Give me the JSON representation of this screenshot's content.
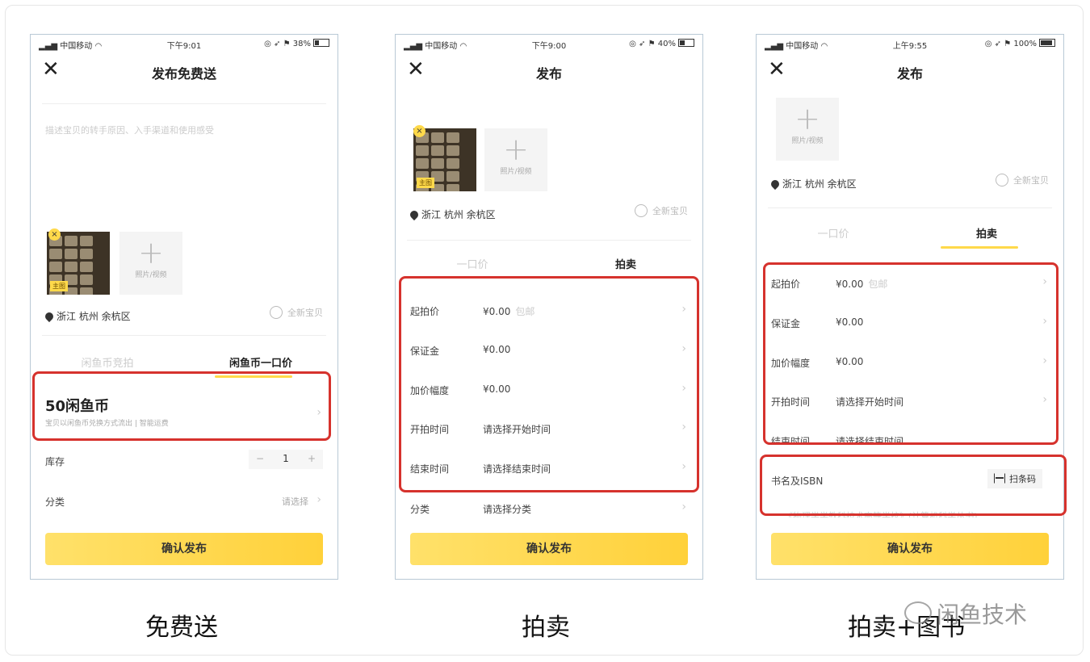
{
  "status_bars": [
    {
      "carrier": "中国移动",
      "time": "下午9:01",
      "battery": "38%",
      "battery_level": 0.38
    },
    {
      "carrier": "中国移动",
      "time": "下午9:00",
      "battery": "40%",
      "battery_level": 0.4
    },
    {
      "carrier": "中国移动",
      "time": "上午9:55",
      "battery": "100%",
      "battery_level": 1.0
    }
  ],
  "phone1": {
    "title": "发布免费送",
    "description_placeholder": "描述宝贝的转手原因、入手渠道和使用感受",
    "main_tag": "主图",
    "add_label": "照片/视频",
    "location": "浙江 杭州 余杭区",
    "new_item": "全新宝贝",
    "tabs": [
      "闲鱼币竞拍",
      "闲鱼币一口价"
    ],
    "coin_amount": "50闲鱼币",
    "coin_desc": "宝贝以闲鱼币兑换方式流出 | 智能运费",
    "stock_label": "库存",
    "stock_value": "1",
    "minus": "−",
    "plus": "+",
    "category_label": "分类",
    "category_value": "请选择",
    "confirm": "确认发布"
  },
  "phone2": {
    "title": "发布",
    "main_tag": "主图",
    "add_label": "照片/视频",
    "location": "浙江 杭州 余杭区",
    "new_item": "全新宝贝",
    "tabs": [
      "一口价",
      "拍卖"
    ],
    "rows": [
      {
        "label": "起拍价",
        "value": "¥0.00",
        "placeholder": "包邮"
      },
      {
        "label": "保证金",
        "value": "¥0.00",
        "placeholder": ""
      },
      {
        "label": "加价幅度",
        "value": "¥0.00",
        "placeholder": ""
      },
      {
        "label": "开拍时间",
        "value": "请选择开始时间",
        "placeholder": ""
      },
      {
        "label": "结束时间",
        "value": "请选择结束时间",
        "placeholder": ""
      },
      {
        "label": "分类",
        "value": "请选择分类",
        "placeholder": ""
      }
    ],
    "confirm": "确认发布"
  },
  "phone3": {
    "title": "发布",
    "add_label": "照片/视频",
    "location": "浙江 杭州 余杭区",
    "new_item": "全新宝贝",
    "tabs": [
      "一口价",
      "拍卖"
    ],
    "rows": [
      {
        "label": "起拍价",
        "value": "¥0.00",
        "placeholder": "包邮"
      },
      {
        "label": "保证金",
        "value": "¥0.00",
        "placeholder": ""
      },
      {
        "label": "加价幅度",
        "value": "¥0.00",
        "placeholder": ""
      },
      {
        "label": "开拍时间",
        "value": "请选择开始时间",
        "placeholder": ""
      },
      {
        "label": "结束时间",
        "value": "请选择结束时间",
        "placeholder": ""
      }
    ],
    "isbn_label": "书名及ISBN",
    "scan_label": "扫条码",
    "isbn_placeholder": "《物理学学教科技术高等学校》(计算机科学丛书)",
    "confirm": "确认发布"
  },
  "captions": [
    "免费送",
    "拍卖",
    "拍卖+图书"
  ],
  "watermark": "闲鱼技术",
  "colors": {
    "accent_yellow": "#ffd94a",
    "highlight_red": "#d6322d",
    "phone_border": "#b9c9d6"
  },
  "icons": [
    "close-icon",
    "plus-icon",
    "location-pin-icon",
    "radio-icon",
    "chevron-right-icon",
    "scan-icon",
    "wifi-icon",
    "battery-icon",
    "wechat-icon"
  ]
}
